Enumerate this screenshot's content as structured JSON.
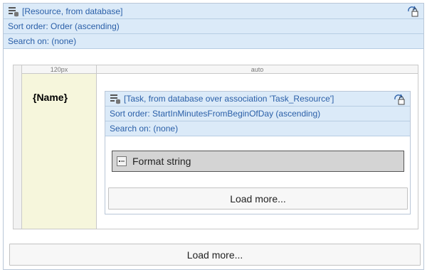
{
  "outer": {
    "title": "[Resource, from database]",
    "sort": "Sort order: Order (ascending)",
    "search": "Search on: (none)",
    "load_more": "Load more..."
  },
  "grid": {
    "col_a": "120px",
    "col_b": "auto",
    "name_label": "{Name}"
  },
  "inner": {
    "title": "[Task, from database over association 'Task_Resource']",
    "sort": "Sort order: StartInMinutesFromBeginOfDay (ascending)",
    "search": "Search on: (none)",
    "format_string": "Format string",
    "load_more": "Load more..."
  }
}
